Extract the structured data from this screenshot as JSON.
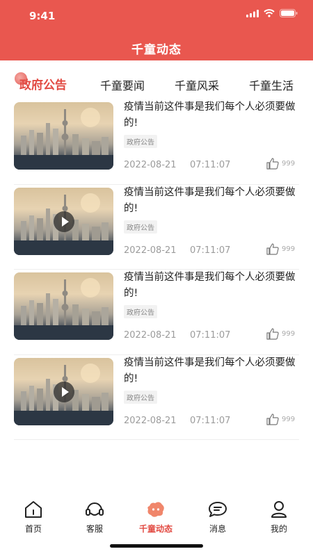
{
  "status_bar": {
    "time": "9:41"
  },
  "header": {
    "title": "千童动态"
  },
  "tabs": [
    {
      "label": "政府公告",
      "active": true
    },
    {
      "label": "千童要闻",
      "active": false
    },
    {
      "label": "千童风采",
      "active": false
    },
    {
      "label": "千童生活",
      "active": false
    }
  ],
  "articles": [
    {
      "title": "疫情当前这件事是我们每个人必须要做的!",
      "tag": "政府公告",
      "date": "2022-08-21",
      "time": "07:11:07",
      "likes": "999",
      "video": false
    },
    {
      "title": "疫情当前这件事是我们每个人必须要做的!",
      "tag": "政府公告",
      "date": "2022-08-21",
      "time": "07:11:07",
      "likes": "999",
      "video": true
    },
    {
      "title": "疫情当前这件事是我们每个人必须要做的!",
      "tag": "政府公告",
      "date": "2022-08-21",
      "time": "07:11:07",
      "likes": "999",
      "video": false
    },
    {
      "title": "疫情当前这件事是我们每个人必须要做的!",
      "tag": "政府公告",
      "date": "2022-08-21",
      "time": "07:11:07",
      "likes": "999",
      "video": true
    }
  ],
  "tabbar": [
    {
      "label": "首页",
      "icon": "home-icon",
      "active": false
    },
    {
      "label": "客服",
      "icon": "headset-icon",
      "active": false
    },
    {
      "label": "千童动态",
      "icon": "news-blob-icon",
      "active": true
    },
    {
      "label": "消息",
      "icon": "chat-icon",
      "active": false
    },
    {
      "label": "我的",
      "icon": "user-icon",
      "active": false
    }
  ],
  "colors": {
    "brand": "#e9574f",
    "accent": "#e24a42",
    "inactive_text": "#9b9b9b"
  }
}
